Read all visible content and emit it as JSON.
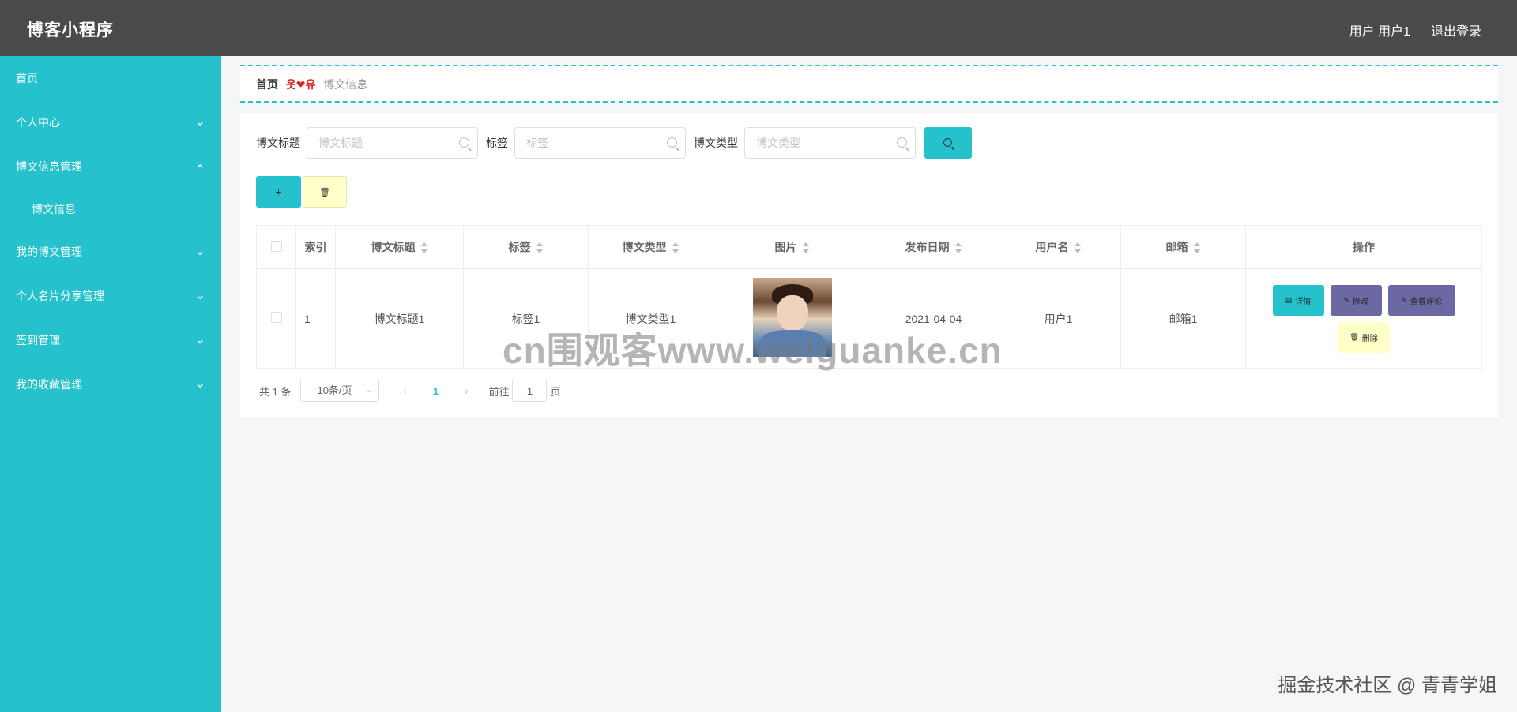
{
  "header": {
    "title": "博客小程序",
    "user": "用户 用户1",
    "logout": "退出登录"
  },
  "sidebar": {
    "items": [
      {
        "label": "首页"
      },
      {
        "label": "个人中心"
      },
      {
        "label": "博文信息管理"
      },
      {
        "label": "博文信息"
      },
      {
        "label": "我的博文管理"
      },
      {
        "label": "个人名片分享管理"
      },
      {
        "label": "签到管理"
      },
      {
        "label": "我的收藏管理"
      }
    ]
  },
  "breadcrumb": {
    "home": "首页",
    "separator": "옷❤유",
    "current": "博文信息"
  },
  "search": {
    "title_label": "博文标题",
    "title_placeholder": "博文标题",
    "tag_label": "标签",
    "tag_placeholder": "标签",
    "type_label": "博文类型",
    "type_placeholder": "博文类型"
  },
  "actions": {
    "add": "+",
    "delete_icon": "trash-icon"
  },
  "table": {
    "headers": [
      "索引",
      "博文标题",
      "标签",
      "博文类型",
      "图片",
      "发布日期",
      "用户名",
      "邮箱",
      "操作"
    ],
    "rows": [
      {
        "index": "1",
        "title": "博文标题1",
        "tag": "标签1",
        "type": "博文类型1",
        "date": "2021-04-04",
        "username": "用户1",
        "email": "邮箱1"
      }
    ],
    "ops": {
      "detail": "详情",
      "edit": "修改",
      "comment": "查看评论",
      "delete": "删除"
    }
  },
  "pagination": {
    "total": "共 1 条",
    "page_size": "10条/页",
    "current": "1",
    "goto": "前往",
    "goto_value": "1",
    "unit": "页"
  },
  "watermark": {
    "center": "cn围观客www.weiguanke.cn",
    "corner": "掘金技术社区 @ 青青学姐"
  },
  "colors": {
    "header": "#4a4a4a",
    "sidebar": "#25c1cc",
    "accent": "#25c1cc",
    "purple": "#6c68a3",
    "yellow": "#ffffc8"
  }
}
